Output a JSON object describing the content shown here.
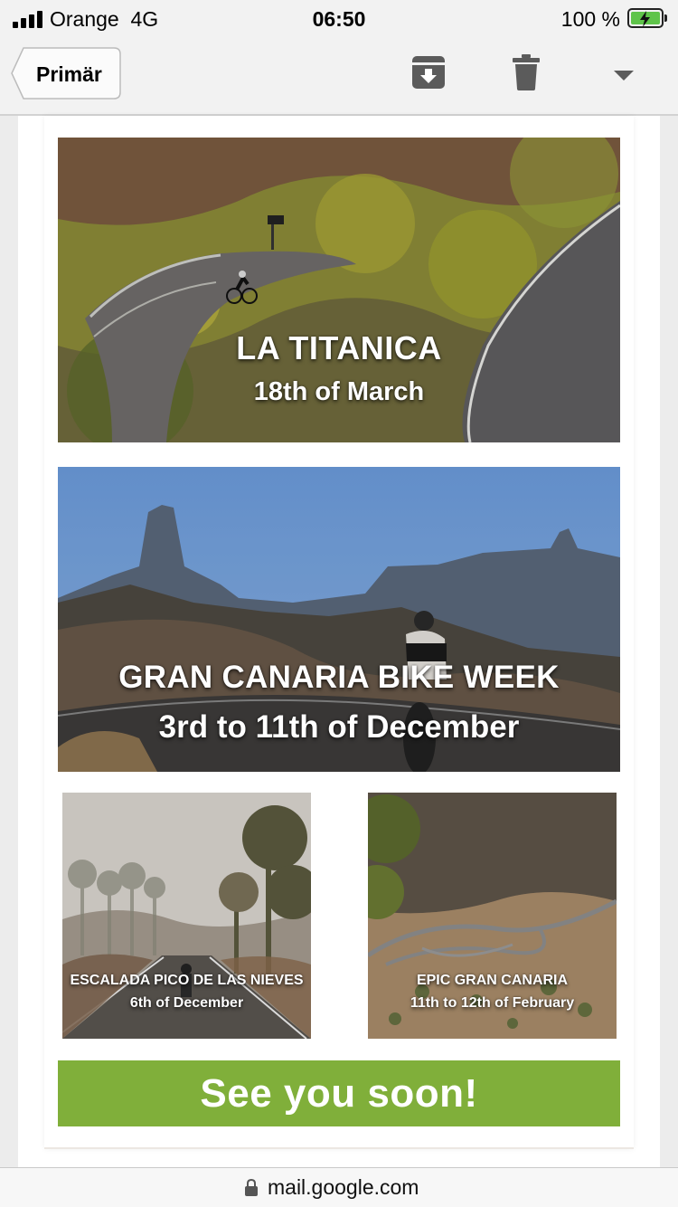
{
  "status_bar": {
    "carrier": "Orange",
    "network": "4G",
    "time": "06:50",
    "battery": "100 %",
    "battery_level": 1.0,
    "battery_color": "#5fc44a"
  },
  "toolbar": {
    "back_label": "Primär",
    "icons": [
      "archive-icon",
      "trash-icon",
      "more-options-icon"
    ]
  },
  "email": {
    "banners": [
      {
        "title": "LA TITANICA",
        "subtitle": "18th of March"
      },
      {
        "title": "GRAN CANARIA BIKE WEEK",
        "subtitle": "3rd to 11th of December"
      }
    ],
    "tiles": [
      {
        "title": "ESCALADA PICO DE LAS NIEVES",
        "subtitle": "6th of December"
      },
      {
        "title": "EPIC GRAN CANARIA",
        "subtitle": "11th to 12th of February"
      }
    ],
    "cta_label": "See you soon!",
    "cta_color": "#80af3a"
  },
  "address_bar": {
    "url": "mail.google.com"
  }
}
